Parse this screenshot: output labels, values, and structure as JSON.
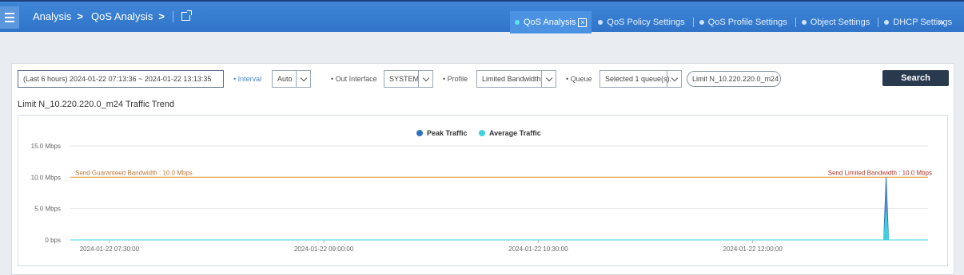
{
  "header": {
    "breadcrumb": [
      "Analysis",
      "QoS Analysis"
    ],
    "tabs": [
      {
        "label": "QoS Analysis",
        "active": true
      },
      {
        "label": "QoS Policy Settings",
        "active": false
      },
      {
        "label": "QoS Profile Settings",
        "active": false
      },
      {
        "label": "Object Settings",
        "active": false
      },
      {
        "label": "DHCP Settings",
        "active": false
      }
    ],
    "more": "»"
  },
  "filters": {
    "time_range": "(Last 6 hours) 2024-01-22 07:13:36 ~ 2024-01-22 13:13:35",
    "interval_label": "Interval",
    "interval_value": "Auto",
    "out_interface_label": "Out Interface",
    "out_interface_value": "SYSTEM",
    "profile_label": "Profile",
    "profile_value": "Limited Bandwidth",
    "queue_label": "Queue",
    "queue_value": "Selected 1 queue(s).",
    "queue_tag": "Limit N_10.220.220.0_m24",
    "search_label": "Search"
  },
  "trend_title": "Limit N_10.220.220.0_m24 Traffic Trend",
  "colors": {
    "peak": "#2f74c0",
    "average": "#3fd3e0",
    "guaranteed_line": "#e8a23a",
    "limited_line": "#b03a2e"
  },
  "chart_data": {
    "type": "area",
    "legend": [
      "Peak Traffic",
      "Average Traffic"
    ],
    "legend_position": "top-center",
    "y_ticks": [
      "15.0 Mbps",
      "10.0 Mbps",
      "5.0 Mbps",
      "0 bps"
    ],
    "ylim": [
      0,
      15
    ],
    "y_unit": "Mbps",
    "x_ticks": [
      "2024-01-22 07:30:00",
      "2024-01-22 09:00:00",
      "2024-01-22 10:30:00",
      "2024-01-22 12:00:00"
    ],
    "xlim": [
      "2024-01-22 07:13:36",
      "2024-01-22 13:13:35"
    ],
    "grid": true,
    "reference_lines": [
      {
        "label": "Send Guaranteed Bandwidth : 10.0 Mbps",
        "value": 10.0
      },
      {
        "label": "Send Limited Bandwidth : 10.0 Mbps",
        "value": 10.0
      }
    ],
    "series": [
      {
        "name": "Peak Traffic",
        "x": [
          "2024-01-22 07:13:36",
          "2024-01-22 12:55:00",
          "2024-01-22 12:56:00",
          "2024-01-22 12:57:00",
          "2024-01-22 13:13:35"
        ],
        "values": [
          0,
          0,
          10.0,
          0,
          0
        ]
      },
      {
        "name": "Average Traffic",
        "x": [
          "2024-01-22 07:13:36",
          "2024-01-22 12:55:00",
          "2024-01-22 12:56:00",
          "2024-01-22 12:57:00",
          "2024-01-22 13:13:35"
        ],
        "values": [
          0,
          0,
          4.5,
          0,
          0
        ]
      }
    ]
  }
}
